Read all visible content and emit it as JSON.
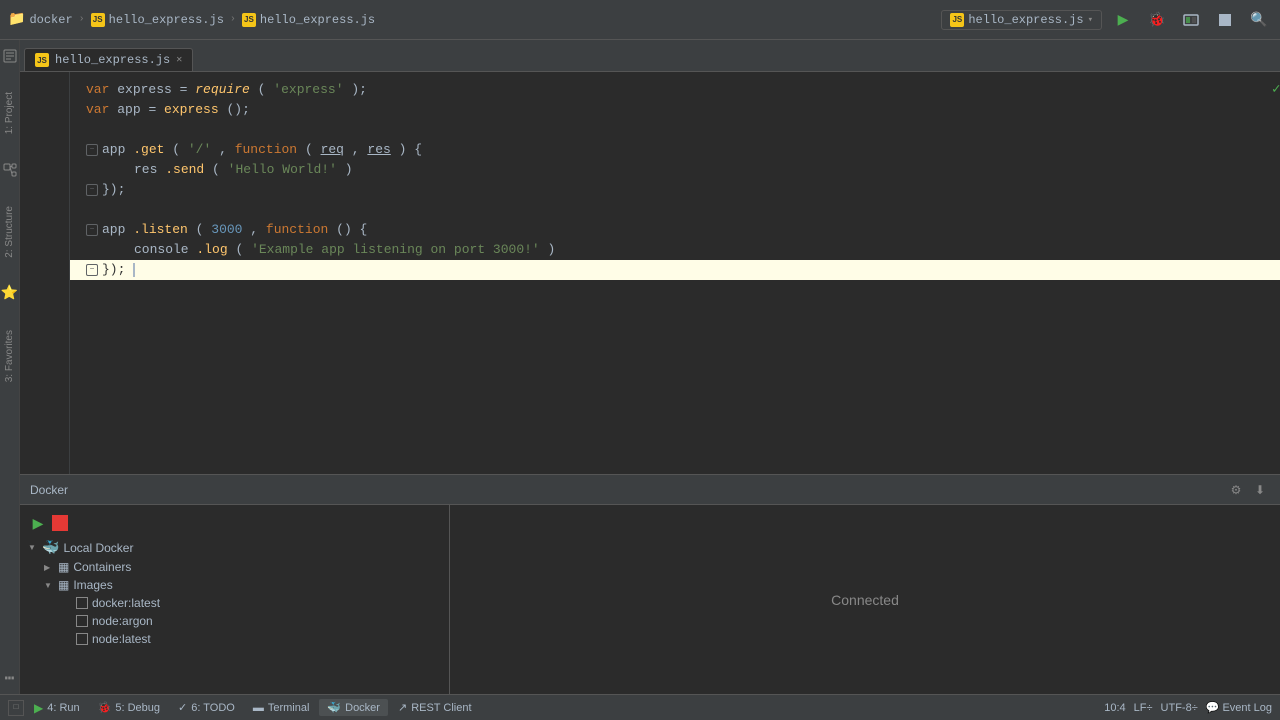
{
  "topbar": {
    "breadcrumbs": [
      {
        "label": "docker",
        "type": "folder"
      },
      {
        "label": "hello_express.js",
        "type": "js"
      },
      {
        "label": "hello_express.js",
        "type": "js"
      }
    ],
    "file_selector": "hello_express.js",
    "chevron": "▾"
  },
  "tabs": [
    {
      "label": "hello_express.js",
      "active": true
    }
  ],
  "editor": {
    "lines": [
      {
        "num": "",
        "content": "var_express_require",
        "type": "var_require"
      },
      {
        "num": "",
        "content": "var_app_express",
        "type": "var_app"
      },
      {
        "num": "",
        "content": "blank"
      },
      {
        "num": "",
        "content": "app_get_fold",
        "type": "app_get",
        "foldable": true
      },
      {
        "num": "",
        "content": "res_send",
        "type": "res_send",
        "indent": true
      },
      {
        "num": "",
        "content": "close_brace",
        "type": "close",
        "foldable": true
      },
      {
        "num": "",
        "content": "blank"
      },
      {
        "num": "",
        "content": "app_listen_fold",
        "type": "app_listen",
        "foldable": true
      },
      {
        "num": "",
        "content": "console_log",
        "type": "console_log",
        "indent": true
      },
      {
        "num": "",
        "content": "close_brace_cursor",
        "type": "close_cursor",
        "foldable": true,
        "highlighted": true
      }
    ],
    "code": {
      "line1": {
        "prefix": "var ",
        "name": "express",
        "eq": " = ",
        "fn": "require",
        "arg": "'express'",
        "semi": ";"
      },
      "line2": {
        "prefix": "var ",
        "name": "app",
        "eq": " = ",
        "fn": "express",
        "args": "()",
        "semi": ";"
      },
      "line4": {
        "obj": "app",
        "method": ".get",
        "arg1": "'/'",
        "kw": "function",
        "p1": "req",
        "p2": "res",
        "rest": ") {"
      },
      "line5": {
        "obj": "res",
        "method": ".send",
        "arg": "'Hello World!'",
        "rest": ")"
      },
      "line6": {
        "text": "});"
      },
      "line8": {
        "obj": "app",
        "method": ".listen",
        "num": "3000",
        "kw": "function",
        "rest": "() {"
      },
      "line9": {
        "obj": "console",
        "method": ".log",
        "arg": "'Example app listening on port 3000!'",
        "rest": ")"
      },
      "line10": {
        "text": "});"
      }
    }
  },
  "docker_panel": {
    "title": "Docker",
    "tree": {
      "root": {
        "label": "Local Docker",
        "children": [
          {
            "label": "Containers",
            "expanded": false
          },
          {
            "label": "Images",
            "expanded": true,
            "children": [
              {
                "label": "docker:latest"
              },
              {
                "label": "node:argon"
              },
              {
                "label": "node:latest"
              }
            ]
          }
        ]
      }
    },
    "status": "Connected"
  },
  "status_bar": {
    "items": [
      {
        "icon": "▶",
        "label": "4: Run",
        "type": "run"
      },
      {
        "icon": "🐛",
        "label": "5: Debug",
        "type": "debug"
      },
      {
        "icon": "✓",
        "label": "6: TODO",
        "type": "todo"
      },
      {
        "icon": "▬",
        "label": "Terminal",
        "type": "terminal"
      },
      {
        "icon": "🐳",
        "label": "Docker",
        "type": "docker",
        "active": true
      },
      {
        "icon": "↗",
        "label": "REST Client",
        "type": "rest"
      }
    ],
    "right": {
      "position": "10:4",
      "encoding": "LF÷",
      "charset": "UTF-8÷",
      "event_log": "Event Log"
    }
  },
  "vertical_labels": [
    "1: Project",
    "2: Structure",
    "3: Favorites"
  ],
  "icons": {
    "folder": "📁",
    "js": "JS",
    "run": "▶",
    "stop": "⏹",
    "debug": "🐞",
    "settings": "⚙",
    "download": "⬇",
    "search": "🔍",
    "close": "✕",
    "tick": "✓",
    "chevron_right": "▶",
    "chevron_down": "▼",
    "minus": "−",
    "plus": "+"
  }
}
